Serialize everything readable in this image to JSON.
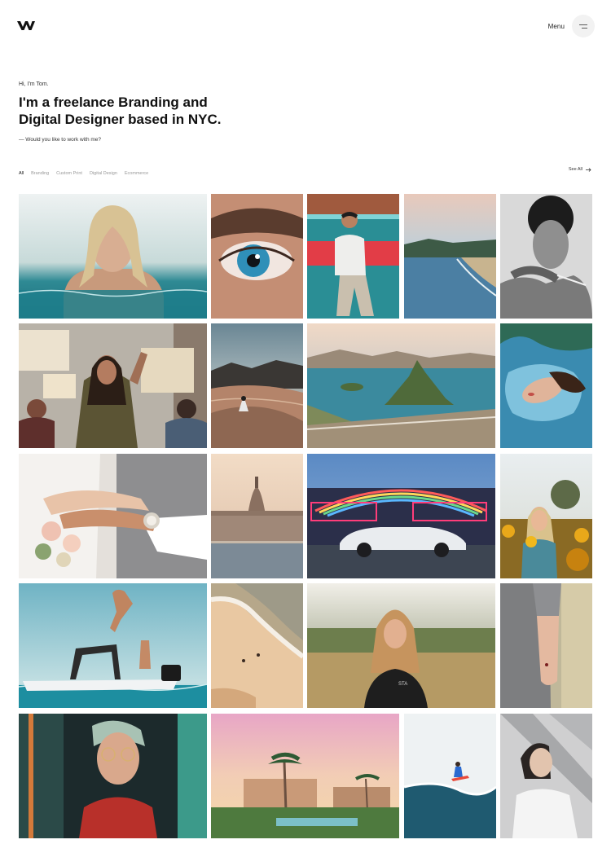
{
  "header": {
    "logo_icon": "w-logo-icon",
    "menu_label": "Menu",
    "menu_icon": "hamburger-icon"
  },
  "hero": {
    "greeting": "Hi, I'm Tom.",
    "headline_line1": "I'm a freelance Branding and",
    "headline_line2": "Digital Designer based in NYC.",
    "cta": "— Would you like to work with me?"
  },
  "filters": {
    "items": [
      "All",
      "Branding",
      "Custom Print",
      "Digital Design",
      "Ecommerce"
    ],
    "active": "All",
    "see_all": "See All",
    "see_all_icon": "arrow-right-icon"
  },
  "gallery": {
    "items": [
      {
        "subject": "woman-in-water"
      },
      {
        "subject": "blue-eye"
      },
      {
        "subject": "man-teal-wall"
      },
      {
        "subject": "beach-coast"
      },
      {
        "subject": "curly-man-bw"
      },
      {
        "subject": "protest-women"
      },
      {
        "subject": "desert-dunes"
      },
      {
        "subject": "rio-aerial"
      },
      {
        "subject": "woman-floating-water"
      },
      {
        "subject": "wedding-hands"
      },
      {
        "subject": "parliament-building"
      },
      {
        "subject": "car-neon-sign"
      },
      {
        "subject": "woman-sunflowers"
      },
      {
        "subject": "boat-jump"
      },
      {
        "subject": "beach-aerial"
      },
      {
        "subject": "woman-wheat-field"
      },
      {
        "subject": "hand-dress"
      },
      {
        "subject": "woman-glasses-neon"
      },
      {
        "subject": "palm-resort"
      },
      {
        "subject": "surfer-wave"
      },
      {
        "subject": "woman-shadow"
      }
    ]
  }
}
